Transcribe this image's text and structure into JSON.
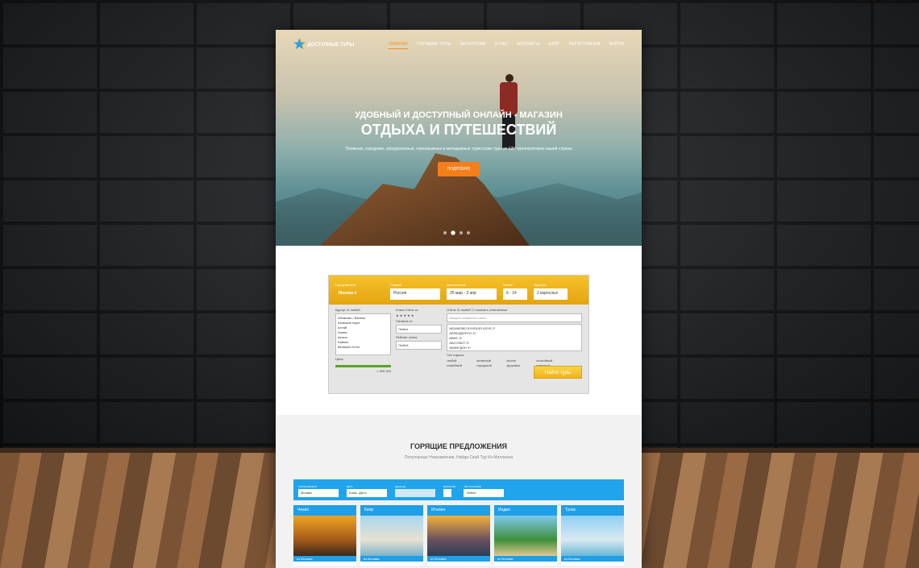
{
  "nav": {
    "logo_text": "ДОСТУПНЫЕ ТУРЫ",
    "items": [
      "ГЛАВНАЯ",
      "ГОРЯЩИЕ ТУРЫ",
      "ЭКСКУРСИИ",
      "О НАС",
      "КОНТАКТЫ",
      "БЛОГ",
      "РЕГИСТРАЦИЯ",
      "ВОЙТИ"
    ]
  },
  "hero": {
    "title_line1": "УДОБНЫЙ И ДОСТУПНЫЙ ОНЛАЙН - МАГАЗИН",
    "title_line2": "ОТДЫХА И ПУТЕШЕСТВИЙ",
    "subtitle": "Пляжные, городские, экскурсионные, горнолыжные и молодежные туристские туры от 120 туроператоров нашей страны",
    "cta": "ПОДРОБНО"
  },
  "search": {
    "from_label": "Город вылета",
    "from_value": "Москва ▾",
    "country_label": "Страна",
    "country_value": "Россия",
    "dates_label": "Дата вылета",
    "dates_value": "25 мар - 3 апр",
    "nights_label": "Ночей",
    "nights_value": "6 - 14",
    "tourists_label": "Туристы",
    "tourists_value": "2 взрослых",
    "resort_label": "Курорт",
    "resort_any": "любой",
    "resorts": [
      "Абзаково / Банное",
      "Азовское море",
      "Алтай",
      "Анапа",
      "Архыз",
      "Байкал",
      "Великий Устюг"
    ],
    "stars_label": "Класс отеля от",
    "meal_label": "Питание от",
    "meal_value": "Любое",
    "rating_label": "Рейтинг отеля",
    "rating_value": "Любой",
    "hotel_label": "Отель",
    "hotel_any": "любой",
    "hotel_selected": "показать отмеченные",
    "hotel_placeholder": "Введите название отеля",
    "hotels": [
      "АБЗАКОВО БУНГАЛО КЛУБ 2*",
      "АБРАУДЮРСО 3*",
      "АВИС 3*",
      "АБСОЛЮТ 3*",
      "АБИНГДОН 3*"
    ],
    "price_label": "Цена",
    "price_value": "< 900 000",
    "type_label": "Тип отдыха",
    "types": [
      "любой",
      "активный",
      "deluxe",
      "спокойный",
      "семейный",
      "городской",
      "здоровье",
      "пляжный"
    ],
    "find_button": "Найти туры"
  },
  "hot": {
    "title": "ГОРЯЩИЕ ПРЕДЛОЖЕНИЯ",
    "subtitle": "Популярные Направления, Найди Свой Тур Из Миллиона",
    "filter": {
      "city_label": "ГОРОД ВЫЛЕТА",
      "city_value": "Москва",
      "date_label": "ДАТА",
      "date_value": "Ближ. Даты",
      "price_label": "ЦЕНА ДО",
      "visa_label": "БЕЗ ВИЗЫ",
      "meal_label": "ТИП ПИТАНИЯ",
      "meal_value": "Любое"
    },
    "cards": [
      {
        "country": "Чехия",
        "from": "из Москвы"
      },
      {
        "country": "Кипр",
        "from": "из Москвы"
      },
      {
        "country": "Италия",
        "from": "из Москвы"
      },
      {
        "country": "Индия",
        "from": "из Москвы"
      },
      {
        "country": "Тунис",
        "from": "из Москвы"
      }
    ]
  },
  "colors": {
    "accent": "#f47f1a",
    "blue": "#1f9fe8",
    "yellow": "#f6c12a"
  }
}
